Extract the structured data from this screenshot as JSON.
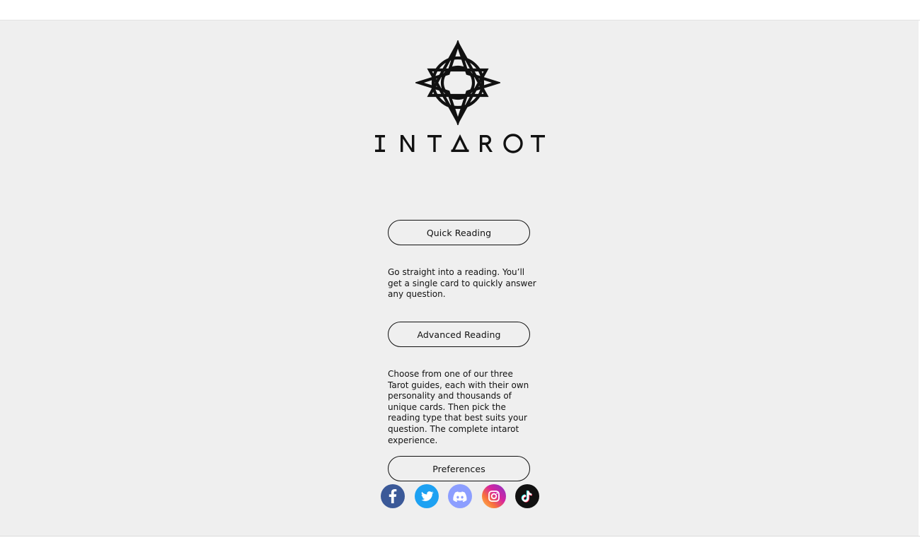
{
  "brand": {
    "name": "INTAROT"
  },
  "menu": {
    "quick_reading": {
      "label": "Quick Reading",
      "description": "Go straight into a reading. You’ll get a single card to quickly answer any question."
    },
    "advanced_reading": {
      "label": "Advanced Reading",
      "description": "Choose from one of our three Tarot guides, each with their own personality and thousands of unique cards. Then pick the reading type that best suits your question. The complete intarot experience."
    },
    "preferences": {
      "label": "Preferences"
    }
  },
  "socials": [
    {
      "icon": "facebook-icon",
      "color": "#3b5998"
    },
    {
      "icon": "twitter-icon",
      "color": "#1da1f2"
    },
    {
      "icon": "discord-icon",
      "color": "#8c9eff"
    },
    {
      "icon": "instagram-icon",
      "color": "#d6249f"
    },
    {
      "icon": "tiktok-icon",
      "color": "#111111"
    }
  ],
  "colors": {
    "background": "#efefef",
    "ink": "#111111"
  }
}
